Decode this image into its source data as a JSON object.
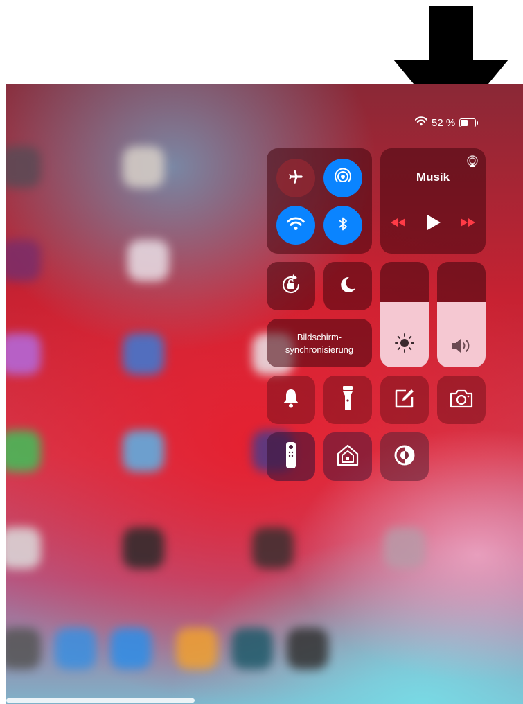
{
  "status_bar": {
    "battery_text": "52 %",
    "battery_level": 0.52
  },
  "control_center": {
    "connectivity": {
      "airplane_mode": {
        "icon": "airplane-icon",
        "active": false
      },
      "airdrop": {
        "icon": "airdrop-icon",
        "active": true
      },
      "wifi": {
        "icon": "wifi-icon",
        "active": true
      },
      "bluetooth": {
        "icon": "bluetooth-icon",
        "active": true
      }
    },
    "music": {
      "title": "Musik",
      "airplay_icon": "airplay-icon",
      "controls": [
        "rewind-icon",
        "play-icon",
        "fast-forward-icon"
      ]
    },
    "screen_mirroring": {
      "line1": "Bildschirm-",
      "line2": "synchronisierung"
    },
    "brightness": {
      "icon": "brightness-icon",
      "level": 0.62
    },
    "volume": {
      "icon": "volume-icon",
      "level": 0.62
    },
    "toggles": [
      "orientation-lock-icon",
      "do-not-disturb-icon",
      "bell-icon",
      "flashlight-icon",
      "notes-icon",
      "camera-icon",
      "apple-tv-remote-icon",
      "home-icon",
      "accessibility-icon"
    ]
  },
  "colors": {
    "accent_blue": "#0a84ff",
    "slider_fill": "#f5c8d2"
  }
}
